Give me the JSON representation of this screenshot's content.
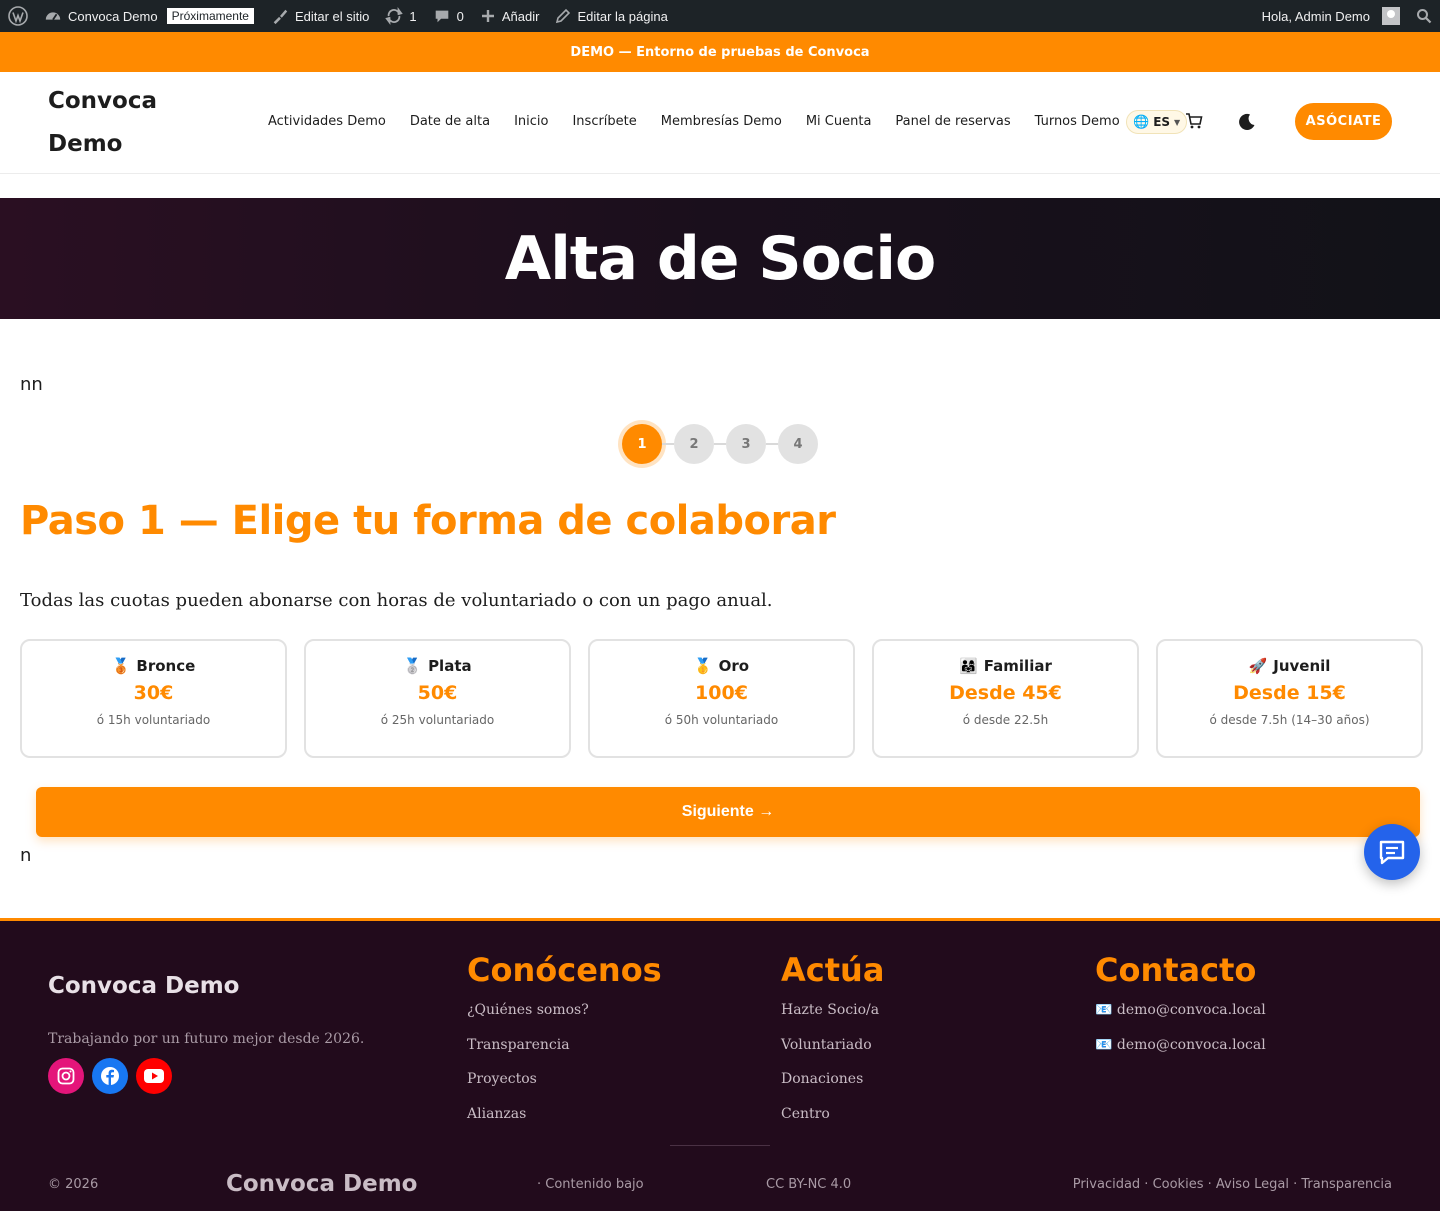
{
  "adminbar": {
    "site_name": "Convoca Demo",
    "site_badge": "Próximamente",
    "edit_site": "Editar el sitio",
    "updates_count": "1",
    "comments_count": "0",
    "add_new": "Añadir",
    "edit_page": "Editar la página",
    "greeting": "Hola, Admin Demo"
  },
  "banner": {
    "text": "DEMO — Entorno de pruebas de Convoca"
  },
  "header": {
    "logo_line1": "Convoca",
    "logo_line2": "Demo",
    "nav": [
      "Actividades Demo",
      "Date de alta",
      "Inicio",
      "Inscríbete",
      "Membresías Demo",
      "Mi Cuenta",
      "Panel de reservas",
      "Turnos Demo"
    ],
    "lang": "ES",
    "cta": "ASÓCIATE"
  },
  "hero": {
    "title": "Alta de Socio"
  },
  "stray_top": "nn",
  "stray_bottom": "n",
  "steps": {
    "items": [
      "1",
      "2",
      "3",
      "4"
    ],
    "active": 1
  },
  "step_title": "Paso 1 — Elige tu forma de colaborar",
  "intro": "Todas las cuotas pueden abonarse con horas de voluntariado o con un pago anual.",
  "plans": [
    {
      "icon": "🥉",
      "name": "Bronce",
      "price": "30€",
      "alt": "ó 15h voluntariado"
    },
    {
      "icon": "🥈",
      "name": "Plata",
      "price": "50€",
      "alt": "ó 25h voluntariado"
    },
    {
      "icon": "🥇",
      "name": "Oro",
      "price": "100€",
      "alt": "ó 50h voluntariado"
    },
    {
      "icon": "👨‍👩‍👧",
      "name": "Familiar",
      "price": "Desde 45€",
      "alt": "ó desde 22.5h"
    },
    {
      "icon": "🚀",
      "name": "Juvenil",
      "price": "Desde 15€",
      "alt": "ó desde 7.5h (14–30 años)"
    }
  ],
  "next_button": "Siguiente →",
  "footer": {
    "brand": "Convoca Demo",
    "tagline": "Trabajando por un futuro mejor desde 2026.",
    "social_icons": [
      "instagram-icon",
      "facebook-icon",
      "youtube-icon"
    ],
    "col1": {
      "title": "Conócenos",
      "links": [
        "¿Quiénes somos?",
        "Transparencia",
        "Proyectos",
        "Alianzas"
      ]
    },
    "col2": {
      "title": "Actúa",
      "links": [
        "Hazte Socio/a",
        "Voluntariado",
        "Donaciones",
        "Centro"
      ]
    },
    "col3": {
      "title": "Contacto",
      "links": [
        "📧 demo@convoca.local",
        "📧 demo@convoca.local"
      ]
    },
    "copyright": "© 2026",
    "bottom_brand": "Convoca Demo",
    "content_under": "· Contenido bajo",
    "license": "CC BY-NC 4.0",
    "legal": "Privacidad · Cookies · Aviso Legal · Transparencia"
  },
  "colors": {
    "accent": "#ff8a00",
    "adminbar": "#1d2327",
    "footer_bg": "#220b1c",
    "chat": "#2463eb"
  }
}
